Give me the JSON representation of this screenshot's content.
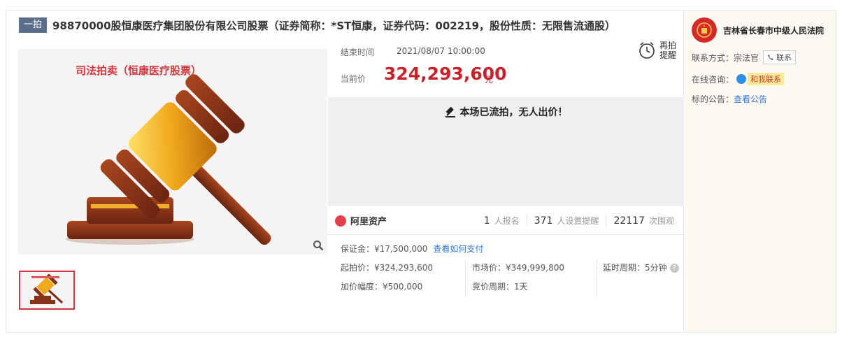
{
  "header": {
    "tag": "一拍",
    "title": "98870000股恒康医疗集团股份有限公司股票（证券简称：*ST恒康，证券代码：002219，股份性质：无限售流通股）"
  },
  "gallery": {
    "image_caption": "司法拍卖（恒康医疗股票）",
    "zoom_icon": "magnifier-icon",
    "thumbnail_count": 1
  },
  "auction": {
    "end_label": "结束时间",
    "end_time": "2021/08/07 10:00:00",
    "remind_label": "再拍提醒",
    "price_label": "当前价",
    "price": "324,293,600",
    "price_unit": "元",
    "status": "本场已流拍，无人出价！"
  },
  "stats": {
    "brand": "阿里资产",
    "items": [
      {
        "num": "1",
        "unit": "人报名"
      },
      {
        "num": "371",
        "unit": "人设置提醒"
      },
      {
        "num": "22117",
        "unit": "次围观"
      }
    ]
  },
  "details": {
    "deposit": "保证金：¥17,500,000",
    "deposit_link": "查看如何支付",
    "start_price": "起拍价：¥324,293,600",
    "market_price": "市场价：¥349,999,800",
    "delay_period": "延时周期：5分钟",
    "increment": "加价幅度：¥500,000",
    "bid_period": "竞价周期：1天"
  },
  "sidebar": {
    "court_name": "吉林省长春市中级人民法院",
    "contact_label": "联系方式：",
    "contact_person": "宗法官",
    "contact_button": "联系",
    "online_label": "在线咨询：",
    "chat_button": "和我联系",
    "notice_label": "标的公告：",
    "notice_link": "查看公告"
  },
  "colors": {
    "accent_red": "#c8232c",
    "tag_bg": "#5b6f8c",
    "link_blue": "#2f77d6"
  }
}
